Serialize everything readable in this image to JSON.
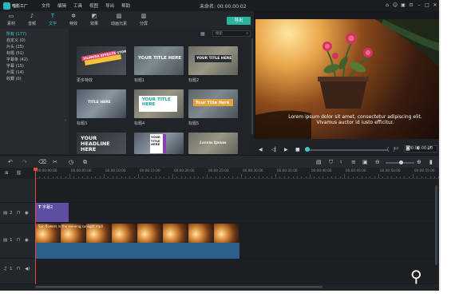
{
  "app": {
    "logo": "喵影工厂",
    "menu": [
      "文件",
      "编辑",
      "工具",
      "视图",
      "导出",
      "帮助"
    ],
    "doc_title": "未命名:",
    "doc_time": "00:00:00:02"
  },
  "toolbar": {
    "tabs": [
      "素材",
      "音频",
      "文字",
      "特效",
      "效果",
      "动画元素",
      "分屏"
    ],
    "active_tab": "文字",
    "export_label": "导出"
  },
  "sidebar": {
    "items": [
      "所有 (177)",
      "自定义 (0)",
      "片头 (25)",
      "标题 (51)",
      "字幕条 (42)",
      "字幕 (15)",
      "片尾 (14)",
      "收藏 (0)"
    ]
  },
  "library": {
    "search_placeholder": "搜索",
    "thumbnails": [
      {
        "label": "更多特效",
        "title": "FILMORA EFFECTS STORE"
      },
      {
        "label": "标题1",
        "title": "YOUR TITLE HERE"
      },
      {
        "label": "标题2",
        "title": "YOUR TITLE HERE"
      },
      {
        "label": "标题3",
        "title": "TITLE HERE"
      },
      {
        "label": "标题4",
        "title": "YOUR TITLE HERE"
      },
      {
        "label": "标题5",
        "title": "Your Title Here"
      },
      {
        "label": "",
        "title": "YOUR HEADLINE HERE"
      },
      {
        "label": "",
        "title": "YOUR TITLE HERE"
      },
      {
        "label": "",
        "title": "Lorem Ipsum"
      }
    ]
  },
  "preview": {
    "subtitle_line1": "Lorem ipsum dolor sit amet, consectetur adipiscing elit.",
    "subtitle_line2": "Vivamus auctor id iusto efficitur.",
    "timecode": "00:00:00:00",
    "progress": 0.02
  },
  "timeline": {
    "ticks": [
      "00:00:00:00",
      "00:00:05:00",
      "00:00:10:00",
      "00:00:15:00",
      "00:00:20:00",
      "00:00:25:00",
      "00:00:30:00",
      "00:00:35:00",
      "00:00:40:00",
      "00:00:45:00",
      "00:00:50:00",
      "00:00:55:00"
    ],
    "tracks": [
      "2",
      "1",
      "1"
    ],
    "text_clip_label": "字幕2",
    "video_clip_label": "Sun flowers in the evening sunlight.mp4"
  },
  "colors": {
    "accent": "#44c3d4",
    "export": "#2bb39c",
    "playhead": "#e24c3c",
    "text_clip": "#5e4fa2",
    "video_clip": "#2f6a98"
  }
}
